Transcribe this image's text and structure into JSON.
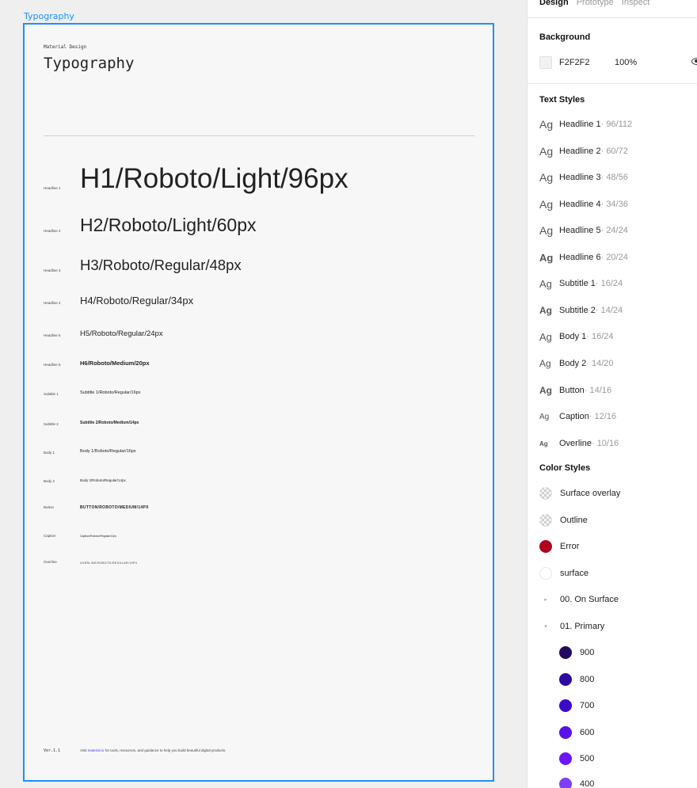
{
  "canvas": {
    "frame_label": "Typography",
    "doc": {
      "eyebrow": "Material Design",
      "title": "Typography",
      "footer": {
        "version": "Ver.1.1",
        "visit_prefix": "Visit ",
        "link_text": "material.io",
        "visit_suffix": " for tools, resources, and guidance to help you build beautiful digital products."
      },
      "styles": [
        {
          "label": "Headline 1",
          "sample": "H1/Roboto/Light/96px"
        },
        {
          "label": "Headline 2",
          "sample": "H2/Roboto/Light/60px"
        },
        {
          "label": "Headline 3",
          "sample": "H3/Roboto/Regular/48px"
        },
        {
          "label": "Headline 4",
          "sample": "H4/Roboto/Regular/34px"
        },
        {
          "label": "Headline 5",
          "sample": "H5/Roboto/Regular/24px"
        },
        {
          "label": "Headline 6",
          "sample": "H6/Roboto/Medium/20px"
        },
        {
          "label": "Subtitle 1",
          "sample": "Subtitle 1/Roboto/Regular/16px"
        },
        {
          "label": "Subtitle 2",
          "sample": "Subtitle 2/Roboto/Medium/14px"
        },
        {
          "label": "Body 1",
          "sample": "Body 1/Roboto/Regular/16px"
        },
        {
          "label": "Body 2",
          "sample": "Body 2/Roboto/Regular/14px"
        },
        {
          "label": "Button",
          "sample": "BUTTON/ROBOTO/MEDIUM/14PX"
        },
        {
          "label": "Caption",
          "sample": "Caption/Roboto/Regular/12px"
        },
        {
          "label": "Overline",
          "sample": "OVERLINE/ROBOTO/REGULAR/10PX"
        }
      ]
    }
  },
  "panel": {
    "tabs": [
      {
        "label": "Design",
        "active": true
      },
      {
        "label": "Prototype",
        "active": false
      },
      {
        "label": "Inspect",
        "active": false
      }
    ],
    "background": {
      "title": "Background",
      "hex": "F2F2F2",
      "opacity": "100%",
      "color": "#F2F2F2"
    },
    "text_styles": {
      "title": "Text Styles",
      "icon_glyph": "Ag",
      "items": [
        {
          "name": "Headline 1",
          "meta": " · 96/112"
        },
        {
          "name": "Headline 2",
          "meta": " · 60/72"
        },
        {
          "name": "Headline 3",
          "meta": " · 48/56"
        },
        {
          "name": "Headline 4",
          "meta": " · 34/36"
        },
        {
          "name": "Headline 5",
          "meta": " · 24/24"
        },
        {
          "name": "Headline 6",
          "meta": " · 20/24"
        },
        {
          "name": "Subtitle 1",
          "meta": " · 16/24"
        },
        {
          "name": "Subtitle 2",
          "meta": " · 14/24"
        },
        {
          "name": "Body 1",
          "meta": " · 16/24"
        },
        {
          "name": "Body 2",
          "meta": " · 14/20"
        },
        {
          "name": "Button",
          "meta": " · 14/16"
        },
        {
          "name": "Caption",
          "meta": " · 12/16"
        },
        {
          "name": "Overline",
          "meta": " · 10/16"
        }
      ]
    },
    "color_styles": {
      "title": "Color Styles",
      "items": [
        {
          "name": "Surface overlay",
          "kind": "checker"
        },
        {
          "name": "Outline",
          "kind": "checker"
        },
        {
          "name": "Error",
          "kind": "solid",
          "color": "#B00020"
        },
        {
          "name": "surface",
          "kind": "outline",
          "color": "#FFFFFF"
        }
      ],
      "groups": [
        {
          "name": "00. On Surface",
          "expanded": false,
          "caret": "▸"
        },
        {
          "name": "01. Primary",
          "expanded": true,
          "caret": "▾"
        }
      ],
      "primary_shades": [
        {
          "name": "900",
          "color": "#220A5E"
        },
        {
          "name": "800",
          "color": "#2C0BA0"
        },
        {
          "name": "700",
          "color": "#3A0BC8"
        },
        {
          "name": "600",
          "color": "#5A10E8"
        },
        {
          "name": "500",
          "color": "#6A16F5"
        },
        {
          "name": "400",
          "color": "#7E40F4"
        }
      ]
    }
  }
}
